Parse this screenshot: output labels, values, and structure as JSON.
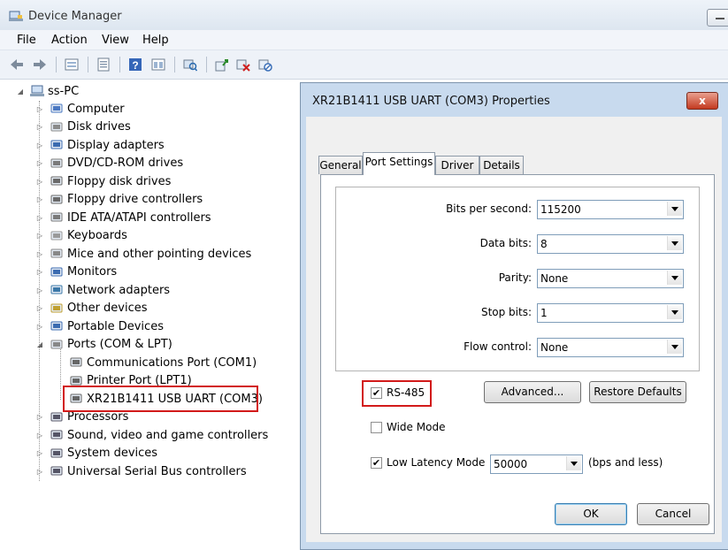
{
  "window": {
    "title": "Device Manager"
  },
  "menu": [
    "File",
    "Action",
    "View",
    "Help"
  ],
  "toolbar_icons": [
    "back-icon",
    "forward-icon",
    "up-icon",
    "properties-icon",
    "help-icon",
    "view-icon",
    "scan-icon",
    "update-driver-icon",
    "uninstall-icon",
    "disable-icon"
  ],
  "tree": {
    "root": "ss-PC",
    "items": [
      "Computer",
      "Disk drives",
      "Display adapters",
      "DVD/CD-ROM drives",
      "Floppy disk drives",
      "Floppy drive controllers",
      "IDE ATA/ATAPI controllers",
      "Keyboards",
      "Mice and other pointing devices",
      "Monitors",
      "Network adapters",
      "Other devices",
      "Portable Devices",
      "Ports (COM & LPT)"
    ],
    "ports_children": [
      "Communications Port (COM1)",
      "Printer Port (LPT1)",
      "XR21B1411 USB UART (COM3)"
    ],
    "items_after": [
      "Processors",
      "Sound, video and game controllers",
      "System devices",
      "Universal Serial Bus controllers"
    ]
  },
  "dialog": {
    "title": "XR21B1411 USB UART (COM3) Properties",
    "close": "x",
    "tabs": [
      "General",
      "Port Settings",
      "Driver",
      "Details"
    ],
    "fields": {
      "bits_per_second": {
        "label": "Bits per second:",
        "value": "115200"
      },
      "data_bits": {
        "label": "Data bits:",
        "value": "8"
      },
      "parity": {
        "label": "Parity:",
        "value": "None"
      },
      "stop_bits": {
        "label": "Stop bits:",
        "value": "1"
      },
      "flow_control": {
        "label": "Flow control:",
        "value": "None"
      }
    },
    "rs485": {
      "label": "RS-485",
      "checked": true
    },
    "wide_mode": {
      "label": "Wide Mode",
      "checked": false
    },
    "low_latency": {
      "label": "Low Latency Mode",
      "checked": true,
      "value": "50000",
      "suffix": "(bps and less)"
    },
    "advanced_button": "Advanced...",
    "restore_button": "Restore Defaults",
    "ok_button": "OK",
    "cancel_button": "Cancel"
  },
  "colors": {
    "highlight_box": "#d21a1a",
    "dialog_frame": "#c8daee"
  }
}
